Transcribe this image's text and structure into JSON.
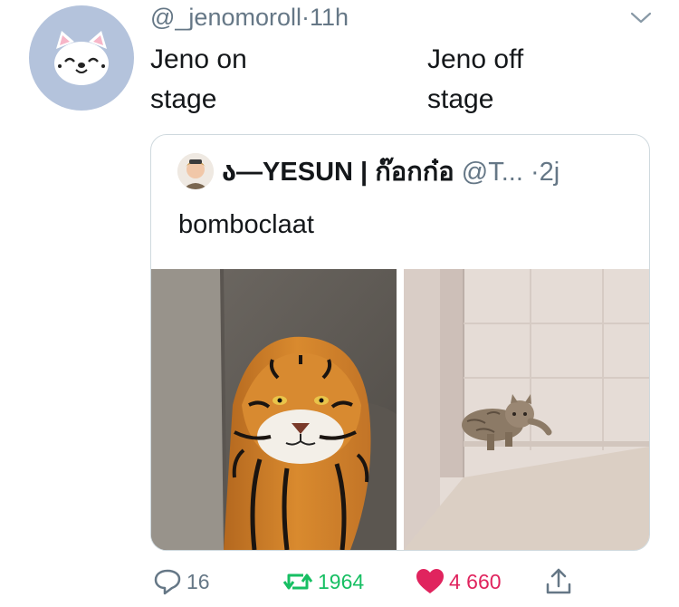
{
  "tweet": {
    "handle": "@_jenomoroll",
    "separator": "·",
    "time": "11h",
    "text_left": "Jeno on\nstage",
    "text_right": "Jeno off\nstage"
  },
  "quote": {
    "name": "ა—YESUN | ก๊อกก๋อ",
    "handle": "@T...",
    "separator": "·",
    "time": "2j",
    "text": "bomboclaat",
    "media": [
      "tiger-photo",
      "cat-photo"
    ]
  },
  "actions": {
    "replies": "16",
    "retweets": "1964",
    "likes": "4 660"
  },
  "colors": {
    "avatar_bg": "#b4c3dc",
    "retweet": "#17bf63",
    "like": "#e0245e",
    "muted": "#657786"
  },
  "icons": [
    "chevron-down-icon",
    "reply-icon",
    "retweet-icon",
    "heart-icon",
    "share-icon"
  ]
}
